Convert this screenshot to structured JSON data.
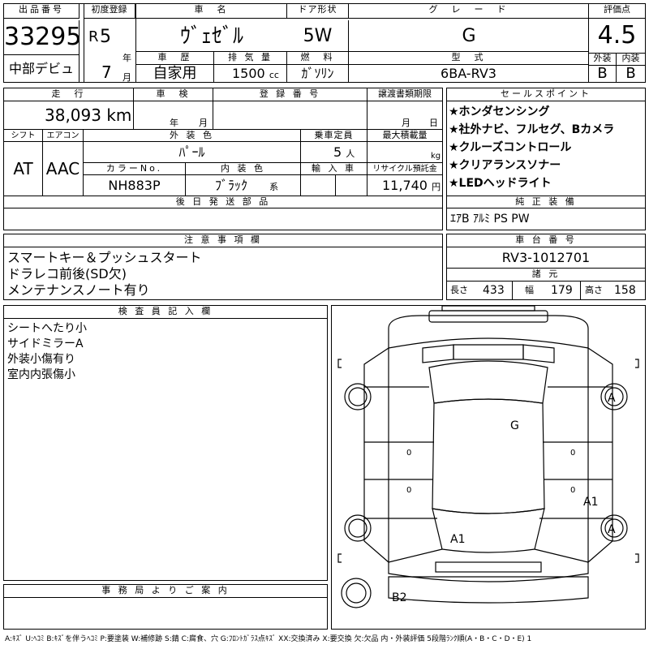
{
  "header": {
    "lot_label": "出品番号",
    "lot_number": "33295",
    "tag": "中部デビュ",
    "first_reg_label": "初度登録",
    "era_letter": "R",
    "era_year": "5",
    "year_unit": "年",
    "month": "7",
    "month_unit": "月",
    "car_name_label": "車　名",
    "car_name": "ｳﾞｪｾﾞﾙ",
    "door_label": "ドア形状",
    "door": "5W",
    "grade_label": "グ　レ　ー　ド",
    "grade": "G",
    "score_label": "評価点",
    "score": "4.5",
    "history_label": "車　歴",
    "history": "自家用",
    "displacement_label": "排 気 量",
    "displacement": "1500",
    "cc": "cc",
    "fuel_label": "燃　料",
    "fuel": "ｶﾞｿﾘﾝ",
    "model_label": "型　式",
    "model": "6BA-RV3",
    "exterior_label": "外装",
    "exterior_grade": "B",
    "interior_label": "内装",
    "interior_grade": "B"
  },
  "row2": {
    "mileage_label": "走　行",
    "mileage": "38,093",
    "km": "km",
    "inspection_label": "車　検",
    "year_unit": "年",
    "month_unit": "月",
    "reg_label": "登 録 番 号",
    "transfer_label": "譲渡書類期限",
    "sales_label": "セールスポイント",
    "shift_label": "シフト",
    "shift": "AT",
    "ac_label": "エアコン",
    "ac": "AAC",
    "color_label": "外 装 色",
    "color": "ﾊﾟｰﾙ",
    "capacity_label": "乗車定員",
    "capacity": "5",
    "person_unit": "人",
    "load_label": "最大積載量",
    "kg": "kg",
    "color_no_label": "カラーNo.",
    "color_no": "NH883P",
    "interior_color_label": "内 装 色",
    "interior_color": "ﾌﾞﾗｯｸ",
    "kei": "系",
    "import_label": "輸 入 車",
    "recycle_label": "リサイクル預託金",
    "recycle": "11,740",
    "yen": "円",
    "later_parts_label": "後 日 発 送 部 品"
  },
  "sales_points": [
    "★ホンダセンシング",
    "★社外ナビ、フルセグ、Bカメラ",
    "★クルーズコントロール",
    "★クリアランスソナー",
    "★LEDヘッドライト"
  ],
  "genuine": {
    "label": "純 正 装 備",
    "value": "ｴｱB ｱﾙﾐ PS PW"
  },
  "notes": {
    "label": "注 意 事 項 欄",
    "lines": [
      "スマートキー＆プッシュスタート",
      "ドラレコ前後(SD欠)",
      "メンテナンスノート有り"
    ]
  },
  "chassis": {
    "label": "車 台 番 号",
    "value": "RV3-1012701",
    "specs_label": "諸 元",
    "length_label": "長さ",
    "length": "433",
    "width_label": "幅",
    "width": "179",
    "height_label": "高さ",
    "height": "158"
  },
  "inspector": {
    "label": "検 査 員 記 入 欄",
    "lines": [
      "シートへたり小",
      "サイドミラーA",
      "外装小傷有り",
      "室内内張傷小"
    ]
  },
  "office": {
    "label": "事 務 局 よ り ご 案 内"
  },
  "diagram": {
    "marks": {
      "g": "G",
      "a1_right": "A1",
      "a1_front": "A1",
      "a_top": "A",
      "a_bottom": "A",
      "b2": "B2",
      "zero": "0"
    }
  },
  "legend": "A:ｷｽﾞ U:ﾍｺﾐ B:ｷｽﾞを伴うﾍｺﾐ P:要塗装 W:補修跡 S:錆 C:腐食、穴 G:ﾌﾛﾝﾄｶﾞﾗｽ点ｷｽﾞ XX:交換済み X:要交換 欠:欠品 内・外装評価 5段階ﾗﾝｸ順(A・B・C・D・E) 1"
}
